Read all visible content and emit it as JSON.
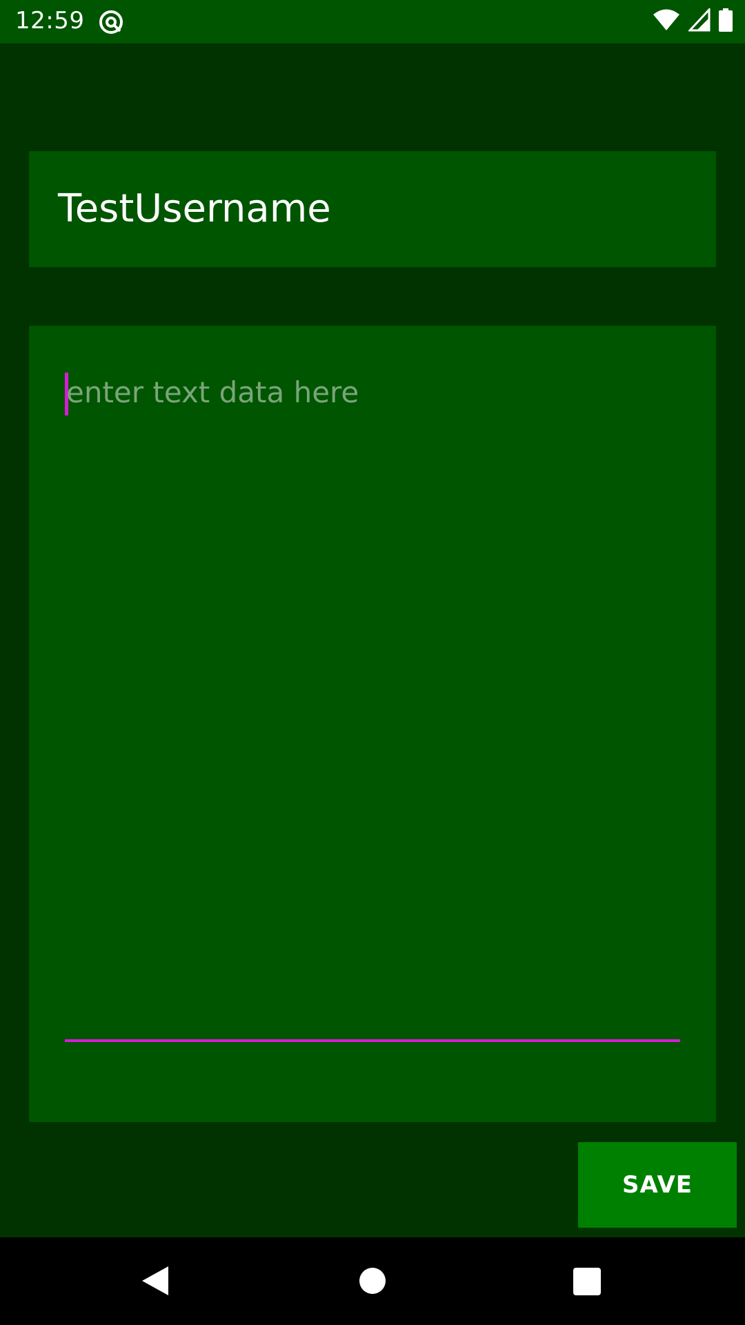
{
  "status_bar": {
    "time": "12:59",
    "icons": [
      "notification-icon",
      "wifi-icon",
      "signal-icon",
      "battery-icon"
    ]
  },
  "username": {
    "value": "TestUsername"
  },
  "text_input": {
    "value": "",
    "placeholder": "enter text data here"
  },
  "save_button": {
    "label": "SAVE"
  },
  "nav_bar": {
    "icons": [
      "back-icon",
      "home-icon",
      "recents-icon"
    ]
  },
  "colors": {
    "status_bar": "#005500",
    "background": "#003300",
    "panel": "#005500",
    "accent": "#d81bd8",
    "button": "#008000",
    "placeholder": "#7aa57a",
    "nav_bar": "#000000"
  }
}
